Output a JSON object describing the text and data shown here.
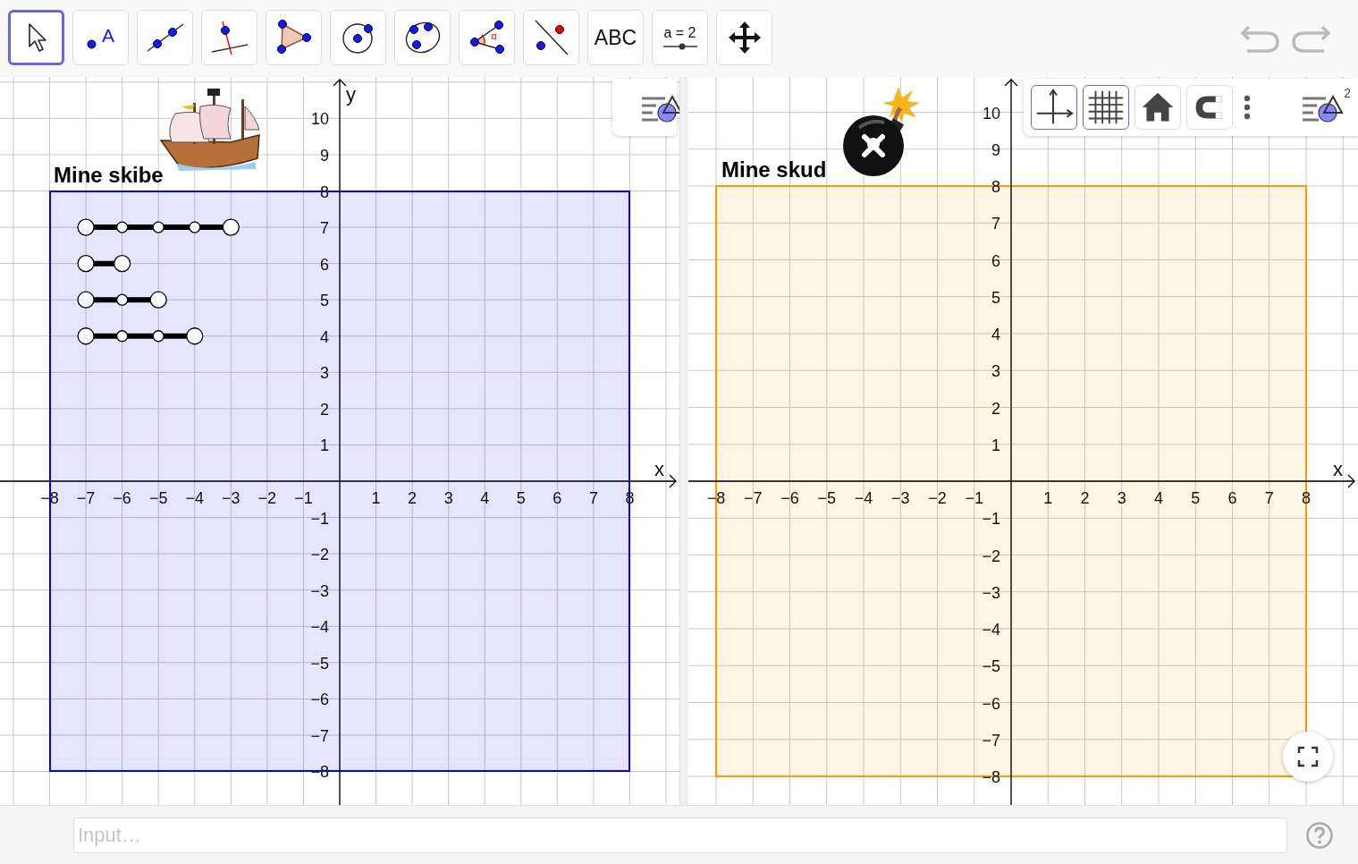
{
  "toolbar": {
    "tools": [
      {
        "kind": "move",
        "selected": true
      },
      {
        "kind": "point",
        "label": "A",
        "selected": false
      },
      {
        "kind": "line",
        "selected": false
      },
      {
        "kind": "perpendicular",
        "selected": false
      },
      {
        "kind": "polygon",
        "selected": false
      },
      {
        "kind": "circle",
        "selected": false
      },
      {
        "kind": "conic",
        "selected": false
      },
      {
        "kind": "angle",
        "label": "α",
        "selected": false
      },
      {
        "kind": "reflect",
        "selected": false
      },
      {
        "kind": "text",
        "label": "ABC",
        "selected": false
      },
      {
        "kind": "slider",
        "label": "a = 2",
        "selected": false
      },
      {
        "kind": "move-view",
        "selected": false
      }
    ],
    "history": [
      {
        "kind": "undo"
      },
      {
        "kind": "redo"
      }
    ]
  },
  "views": [
    {
      "title": "Mine skibe",
      "color": "#0000ff",
      "x_axis_label": "x",
      "y_axis_label": "y",
      "x_ticks": [
        "−8",
        "−7",
        "−6",
        "−5",
        "−4",
        "−3",
        "−2",
        "−1",
        "1",
        "2",
        "3",
        "4",
        "5",
        "6",
        "7",
        "8"
      ],
      "y_ticks": [
        "10",
        "9",
        "8",
        "7",
        "6",
        "5",
        "4",
        "3",
        "2",
        "1",
        "−1",
        "−2",
        "−3",
        "−4",
        "−5",
        "−6",
        "−7",
        "−8"
      ],
      "style_bar": [
        {
          "kind": "style"
        }
      ]
    },
    {
      "title": "Mine skud",
      "color": "#ff9900",
      "x_axis_label": "x",
      "x_ticks": [
        "−8",
        "−7",
        "−6",
        "−5",
        "−4",
        "−3",
        "−2",
        "−1",
        "1",
        "2",
        "3",
        "4",
        "5",
        "6",
        "7",
        "8"
      ],
      "y_ticks": [
        "10",
        "9",
        "8",
        "7",
        "6",
        "5",
        "4",
        "3",
        "2",
        "1",
        "−1",
        "−2",
        "−3",
        "−4",
        "−5",
        "−6",
        "−7",
        "−8"
      ],
      "style_bar": [
        {
          "kind": "axes",
          "selected": true
        },
        {
          "kind": "grid",
          "selected": true
        },
        {
          "kind": "home",
          "selected": false
        },
        {
          "kind": "magnet",
          "selected": false
        },
        {
          "kind": "more"
        },
        {
          "kind": "style",
          "label": "2"
        }
      ],
      "fullscreen_button": true
    }
  ],
  "input_bar": {
    "placeholder": "Input…"
  }
}
